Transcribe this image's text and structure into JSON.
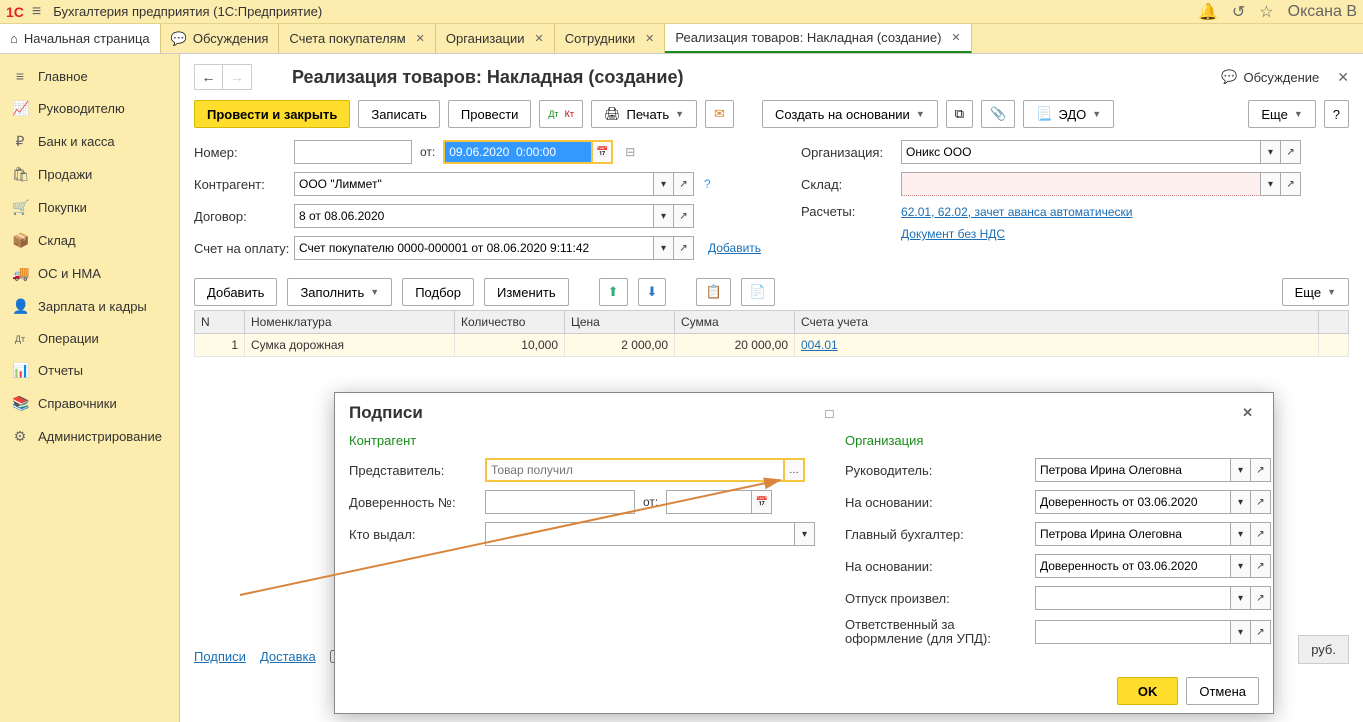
{
  "titlebar": {
    "app_title": "Бухгалтерия предприятия  (1С:Предприятие)",
    "user": "Оксана В"
  },
  "tabs": {
    "home": "Начальная страница",
    "items": [
      {
        "label": "Обсуждения",
        "closable": false
      },
      {
        "label": "Счета покупателям",
        "closable": true
      },
      {
        "label": "Организации",
        "closable": true
      },
      {
        "label": "Сотрудники",
        "closable": true
      },
      {
        "label": "Реализация товаров: Накладная (создание)",
        "closable": true,
        "active": true
      }
    ]
  },
  "sidebar": [
    {
      "icon": "≡",
      "label": "Главное"
    },
    {
      "icon": "📈",
      "label": "Руководителю"
    },
    {
      "icon": "₽",
      "label": "Банк и касса"
    },
    {
      "icon": "🛍",
      "label": "Продажи"
    },
    {
      "icon": "🛒",
      "label": "Покупки"
    },
    {
      "icon": "📦",
      "label": "Склад"
    },
    {
      "icon": "🚚",
      "label": "ОС и НМА"
    },
    {
      "icon": "👤",
      "label": "Зарплата и кадры"
    },
    {
      "icon": "Дт",
      "label": "Операции"
    },
    {
      "icon": "📊",
      "label": "Отчеты"
    },
    {
      "icon": "📚",
      "label": "Справочники"
    },
    {
      "icon": "⚙",
      "label": "Администрирование"
    }
  ],
  "doc": {
    "title": "Реализация товаров: Накладная (создание)",
    "discuss": "Обсуждение",
    "toolbar": {
      "post_close": "Провести и закрыть",
      "save": "Записать",
      "post": "Провести",
      "print": "Печать",
      "create_based": "Создать на основании",
      "edo": "ЭДО",
      "more": "Еще"
    },
    "fields": {
      "number_label": "Номер:",
      "number": "",
      "from_label": "от:",
      "date": "09.06.2020  0:00:00",
      "org_label": "Организация:",
      "org": "Оникс ООО",
      "contragent_label": "Контрагент:",
      "contragent": "ООО \"Лиммет\"",
      "warehouse_label": "Склад:",
      "warehouse": "",
      "contract_label": "Договор:",
      "contract": "8 от 08.06.2020",
      "calc_label": "Расчеты:",
      "calc_link": "62.01, 62.02, зачет аванса автоматически",
      "invoice_label": "Счет на оплату:",
      "invoice": "Счет покупателю 0000-000001 от 08.06.2020 9:11:42",
      "add_link": "Добавить",
      "no_vat_link": "Документ без НДС"
    },
    "subtoolbar": {
      "add": "Добавить",
      "fill": "Заполнить",
      "select": "Подбор",
      "change": "Изменить",
      "more": "Еще"
    },
    "table": {
      "headers": {
        "n": "N",
        "nomen": "Номенклатура",
        "qty": "Количество",
        "price": "Цена",
        "sum": "Сумма",
        "acc": "Счета учета"
      },
      "rows": [
        {
          "n": "1",
          "nomen": "Сумка дорожная",
          "qty": "10,000",
          "price": "2 000,00",
          "sum": "20 000,00",
          "acc": "004.01"
        }
      ]
    },
    "footer": {
      "signs": "Подписи",
      "delivery": "Доставка",
      "rub": "руб."
    }
  },
  "modal": {
    "title": "Подписи",
    "contragent_section": "Контрагент",
    "rep_label": "Представитель:",
    "rep_placeholder": "Товар получил",
    "proxy_label": "Доверенность №:",
    "proxy_from": "от:",
    "issued_label": "Кто выдал:",
    "org_section": "Организация",
    "head_label": "Руководитель:",
    "head_value": "Петрова Ирина Олеговна",
    "based1_label": "На основании:",
    "based1_value": "Доверенность от 03.06.2020",
    "accountant_label": "Главный бухгалтер:",
    "accountant_value": "Петрова Ирина Олеговна",
    "based2_label": "На основании:",
    "based2_value": "Доверенность от 03.06.2020",
    "released_label": "Отпуск произвел:",
    "responsible_label": "Ответственный за оформление (для УПД):",
    "ok": "OK",
    "cancel": "Отмена"
  }
}
